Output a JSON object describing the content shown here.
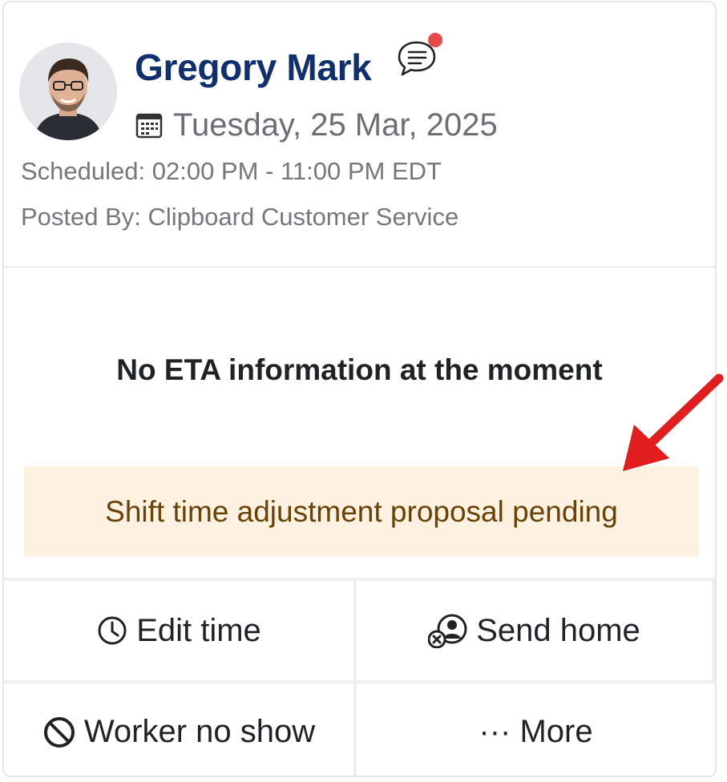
{
  "worker": {
    "name": "Gregory Mark",
    "date": "Tuesday, 25 Mar, 2025",
    "scheduled": "Scheduled: 02:00 PM - 11:00 PM EDT",
    "posted_by": "Posted By: Clipboard Customer Service"
  },
  "icons": {
    "chat": "chat-bubble-icon",
    "calendar": "calendar-icon",
    "clock": "clock-icon",
    "send_home": "send-home-icon",
    "no_show": "prohibited-icon",
    "more": "ellipsis-icon"
  },
  "status": {
    "eta_message": "No ETA information at the moment",
    "banner": "Shift time adjustment proposal pending"
  },
  "actions": {
    "edit_time": "Edit time",
    "send_home": "Send home",
    "no_show": "Worker no show",
    "more": "··· More"
  },
  "colors": {
    "name": "#0f2f6e",
    "notification_dot": "#e84a4a",
    "banner_bg": "#fdf1e1",
    "banner_text": "#6a4204",
    "annotation_arrow": "#e11d1d"
  }
}
